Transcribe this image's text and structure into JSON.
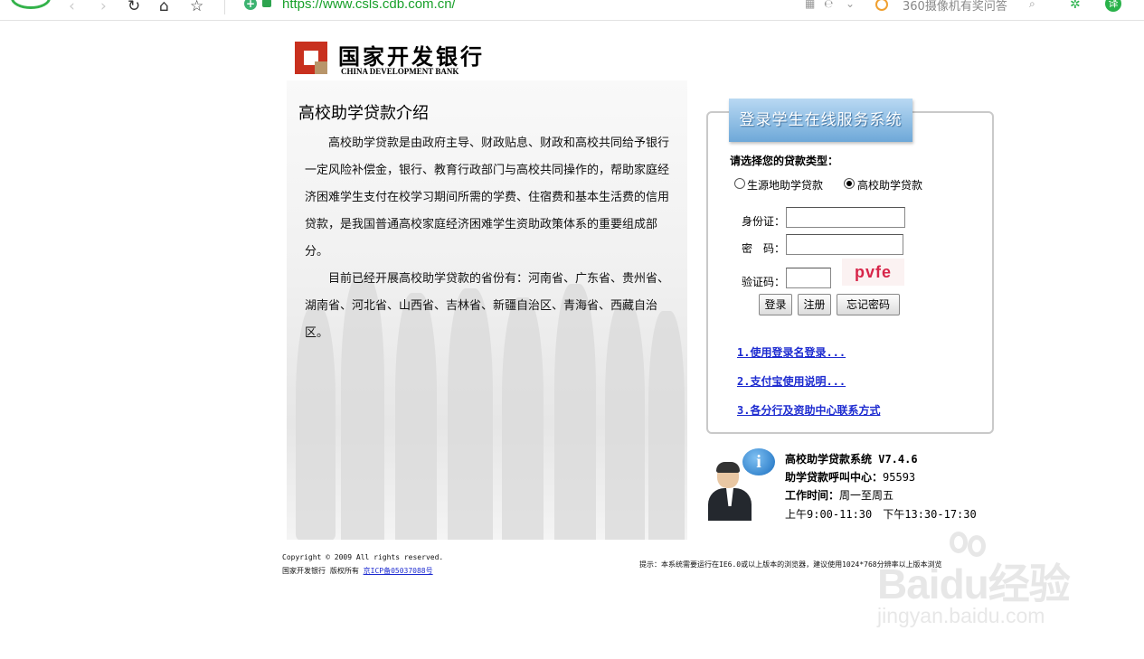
{
  "browser": {
    "url": "https://www.csls.cdb.com.cn/",
    "search_suggestion": "360摄像机有奖问答",
    "user_initial": "译"
  },
  "bank": {
    "name_cn": "国家开发银行",
    "name_en": "CHINA DEVELOPMENT BANK"
  },
  "intro": {
    "title": "高校助学贷款介绍",
    "paragraphs": [
      "高校助学贷款是由政府主导、财政贴息、财政和高校共同给予银行一定风险补偿金，银行、教育行政部门与高校共同操作的，帮助家庭经济困难学生支付在校学习期间所需的学费、住宿费和基本生活费的信用贷款，是我国普通高校家庭经济困难学生资助政策体系的重要组成部分。",
      "目前已经开展高校助学贷款的省份有：河南省、广东省、贵州省、湖南省、河北省、山西省、吉林省、新疆自治区、青海省、西藏自治区。"
    ]
  },
  "login": {
    "header": "登录学生在线服务系统",
    "loan_type_prompt": "请选择您的贷款类型：",
    "loan_types": [
      {
        "label": "生源地助学贷款",
        "selected": false
      },
      {
        "label": "高校助学贷款",
        "selected": true
      }
    ],
    "id_label": "身份证：",
    "id_value": "",
    "password_label": "密　码：",
    "password_value": "",
    "captcha_label": "验证码：",
    "captcha_value": "",
    "captcha_image_text": "pvfe",
    "buttons": {
      "login": "登录",
      "register": "注册",
      "forgot": "忘记密码"
    },
    "links": [
      "1.使用登录名登录...",
      "2.支付宝使用说明...",
      "3.各分行及资助中心联系方式"
    ]
  },
  "info": {
    "system": "高校助学贷款系统 V7.4.6",
    "hotline_label": "助学贷款呼叫中心：",
    "hotline": "95593",
    "hours_label": "工作时间：",
    "days": "周一至周五",
    "hours": "上午9:00-11:30　下午13:30-17:30"
  },
  "footer": {
    "copyright": "Copyright © 2009 All rights reserved.",
    "owner": "国家开发银行 版权所有 ",
    "icp": "京ICP备05037088号",
    "hint": "提示：本系统需要运行在IE6.0或以上版本的浏览器，建议使用1024*768分辨率以上版本浏览"
  },
  "watermark": {
    "brand": "Baidu经验",
    "site": "jingyan.baidu.com"
  }
}
